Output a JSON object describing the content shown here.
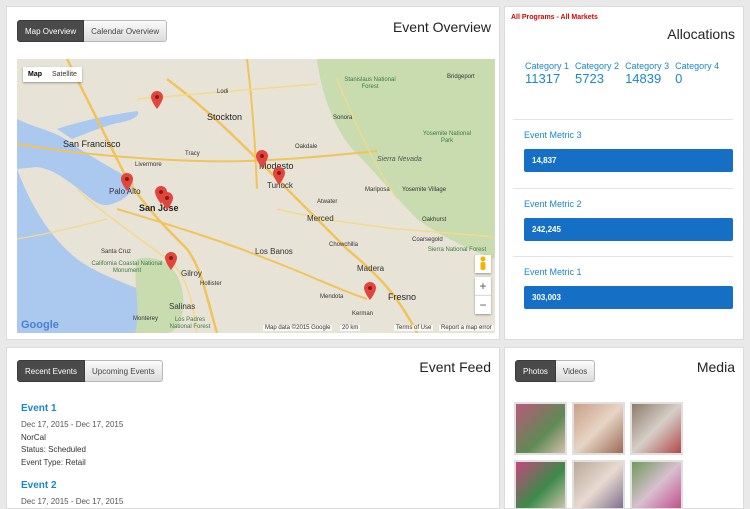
{
  "event_overview": {
    "title": "Event Overview",
    "tabs": [
      {
        "label": "Map Overview",
        "active": true
      },
      {
        "label": "Calendar Overview",
        "active": false
      }
    ]
  },
  "map": {
    "type_buttons": [
      "Map",
      "Satellite"
    ],
    "zoom_in": "+",
    "zoom_out": "−",
    "logo": "Google",
    "footer": {
      "data": "Map data ©2015 Google",
      "scale": "20 km",
      "terms": "Terms of Use",
      "report": "Report a map error"
    },
    "cities": [
      "San Francisco",
      "Stockton",
      "Modesto",
      "Turlock",
      "Palo Alto",
      "San Jose",
      "Merced",
      "Gilroy",
      "Salinas",
      "Fresno",
      "Madera",
      "Los Banos",
      "Hollister",
      "Chowchilla",
      "Mariposa",
      "Sonora",
      "Yosemite Village",
      "Bridgeport",
      "Mendota",
      "Kerman",
      "Livermore",
      "Tracy",
      "Lodi",
      "Oakdale",
      "Atwater",
      "Coarsegold",
      "Oakhurst",
      "Santa Cruz",
      "Monterey"
    ],
    "parks": [
      "Stanislaus National Forest",
      "Yosemite National Park",
      "Sierra National Forest",
      "Sierra Nevada",
      "California Coastal National Monument",
      "Los Padres National Forest"
    ],
    "marker_icon": "map-marker-icon"
  },
  "allocations": {
    "scope": "All Programs - All Markets",
    "title": "Allocations",
    "categories": [
      {
        "label": "Category 1",
        "value": "11317"
      },
      {
        "label": "Category 2",
        "value": "5723"
      },
      {
        "label": "Category 3",
        "value": "14839"
      },
      {
        "label": "Category 4",
        "value": "0"
      }
    ],
    "metrics": [
      {
        "label": "Event Metric 3",
        "value": "14,837"
      },
      {
        "label": "Event Metric 2",
        "value": "242,245"
      },
      {
        "label": "Event Metric 1",
        "value": "303,003"
      }
    ]
  },
  "event_feed": {
    "title": "Event Feed",
    "tabs": [
      {
        "label": "Recent Events",
        "active": true
      },
      {
        "label": "Upcoming Events",
        "active": false
      }
    ],
    "events": [
      {
        "name": "Event 1",
        "dates": "Dec 17, 2015 - Dec 17, 2015",
        "region": "NorCal",
        "status": "Status: Scheduled",
        "type": "Event Type: Retail"
      },
      {
        "name": "Event 2",
        "dates": "Dec 17, 2015 - Dec 17, 2015"
      }
    ]
  },
  "media": {
    "title": "Media",
    "tabs": [
      {
        "label": "Photos",
        "active": true
      },
      {
        "label": "Videos",
        "active": false
      }
    ],
    "thumb_colors": [
      "#b85a7a",
      "#c9a08a",
      "#8f7b6a",
      "#c6477f",
      "#b9a89a",
      "#6f9a5a"
    ]
  }
}
